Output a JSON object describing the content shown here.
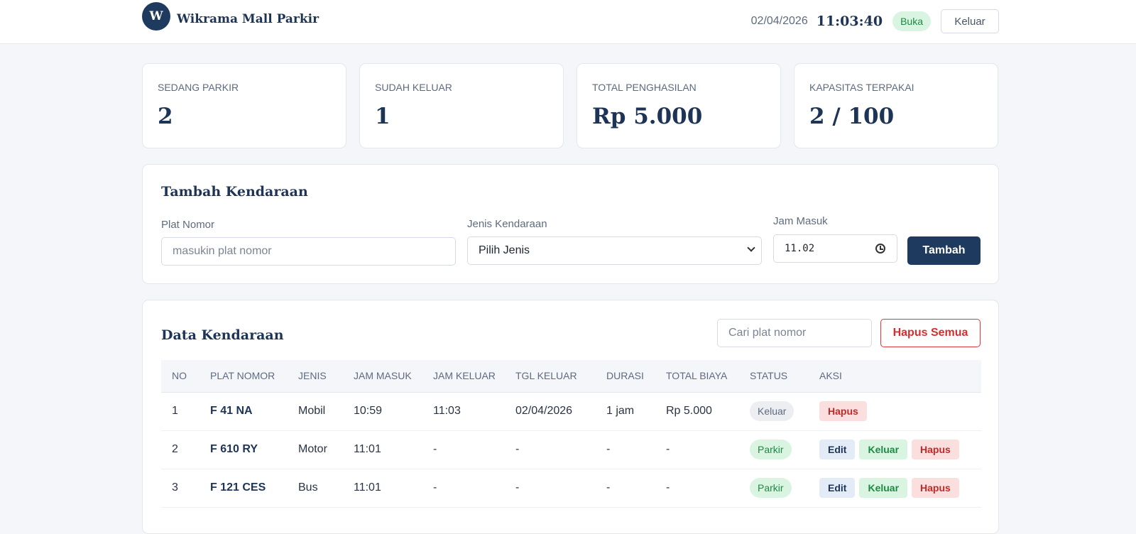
{
  "header": {
    "logo_letter": "W",
    "app_name": "Wikrama Mall Parkir",
    "date": "02/04/2026",
    "time": "11:03:40",
    "status": "Buka",
    "logout_label": "Keluar"
  },
  "stats": [
    {
      "label": "SEDANG PARKIR",
      "value": "2"
    },
    {
      "label": "SUDAH KELUAR",
      "value": "1"
    },
    {
      "label": "TOTAL PENGHASILAN",
      "value": "Rp 5.000"
    },
    {
      "label": "KAPASITAS TERPAKAI",
      "value": "2 / 100"
    }
  ],
  "add_form": {
    "title": "Tambah Kendaraan",
    "plate_label": "Plat Nomor",
    "plate_placeholder": "masukin plat nomor",
    "type_label": "Jenis Kendaraan",
    "type_selected": "Pilih Jenis",
    "time_label": "Jam Masuk",
    "time_value": "11.02",
    "submit_label": "Tambah"
  },
  "data_table": {
    "title": "Data Kendaraan",
    "search_placeholder": "Cari plat nomor",
    "clear_all_label": "Hapus Semua",
    "columns": [
      "NO",
      "PLAT NOMOR",
      "JENIS",
      "JAM MASUK",
      "JAM KELUAR",
      "TGL KELUAR",
      "DURASI",
      "TOTAL BIAYA",
      "STATUS",
      "AKSI"
    ],
    "rows": [
      {
        "no": "1",
        "plate": "F 41 NA",
        "type": "Mobil",
        "in": "10:59",
        "out": "11:03",
        "date_out": "02/04/2026",
        "duration": "1 jam",
        "cost": "Rp 5.000",
        "status": "Keluar",
        "actions": [
          "Hapus"
        ]
      },
      {
        "no": "2",
        "plate": "F 610 RY",
        "type": "Motor",
        "in": "11:01",
        "out": "-",
        "date_out": "-",
        "duration": "-",
        "cost": "-",
        "status": "Parkir",
        "actions": [
          "Edit",
          "Keluar",
          "Hapus"
        ]
      },
      {
        "no": "3",
        "plate": "F 121 CES",
        "type": "Bus",
        "in": "11:01",
        "out": "-",
        "date_out": "-",
        "duration": "-",
        "cost": "-",
        "status": "Parkir",
        "actions": [
          "Edit",
          "Keluar",
          "Hapus"
        ]
      }
    ]
  }
}
